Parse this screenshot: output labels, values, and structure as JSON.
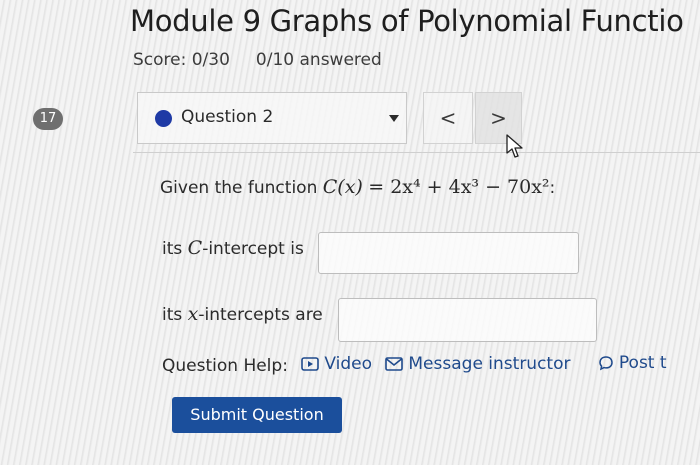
{
  "page": {
    "title": "Module 9 Graphs of Polynomial Functio",
    "score": "Score: 0/30",
    "answered": "0/10 answered"
  },
  "question_nav": {
    "number_badge": "17",
    "selected_question": "Question 2",
    "prev_label": "<",
    "next_label": ">"
  },
  "question": {
    "intro": "Given the function",
    "function_lhs": "C(x)",
    "function_rhs": "= 2x⁴ + 4x³ − 70x²",
    "colon": ":",
    "c_intercept_prefix": "its",
    "c_intercept_var": "C",
    "c_intercept_suffix": "-intercept is",
    "c_intercept_value": "",
    "x_intercepts_prefix": "its",
    "x_intercepts_var": "x",
    "x_intercepts_suffix": "-intercepts are",
    "x_intercepts_value": ""
  },
  "help": {
    "label": "Question Help:",
    "video": "Video",
    "message": "Message instructor",
    "post": "Post t"
  },
  "submit_label": "Submit Question",
  "colors": {
    "accent": "#1b4f9c",
    "dot": "#1f3aa5",
    "badge": "#6f6f6f"
  }
}
